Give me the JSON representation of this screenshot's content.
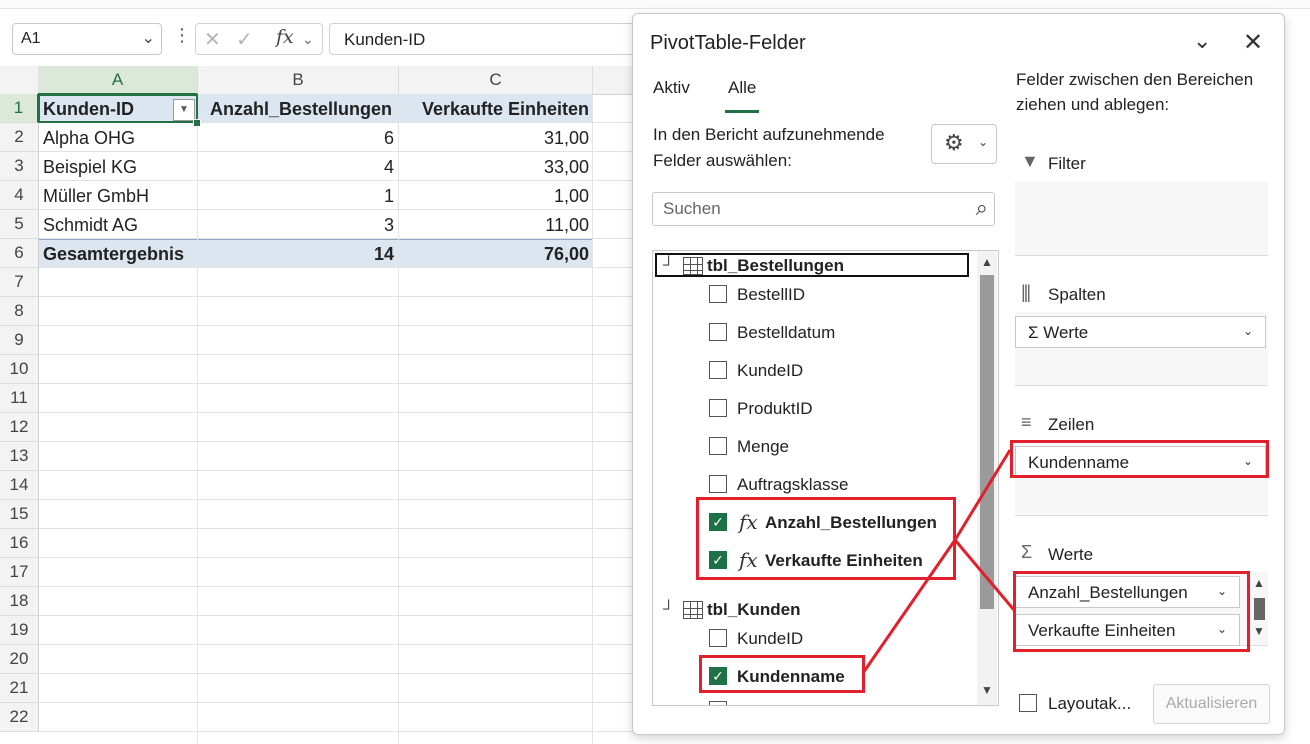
{
  "formula_bar": {
    "name_box": "A1",
    "fx_label": "fx",
    "content": "Kunden-ID"
  },
  "sheet": {
    "columns": [
      "A",
      "B",
      "C"
    ],
    "rows": [
      "1",
      "2",
      "3",
      "4",
      "5",
      "6",
      "7",
      "8",
      "9",
      "10",
      "11",
      "12",
      "13",
      "14",
      "15",
      "16",
      "17",
      "18",
      "19",
      "20",
      "21",
      "22"
    ],
    "headers": [
      "Kunden-ID",
      "Anzahl_Bestellungen",
      "Verkaufte Einheiten"
    ],
    "data": [
      [
        "Alpha OHG",
        "6",
        "31,00"
      ],
      [
        "Beispiel KG",
        "4",
        "33,00"
      ],
      [
        "Müller GmbH",
        "1",
        "1,00"
      ],
      [
        "Schmidt AG",
        "3",
        "11,00"
      ]
    ],
    "total": [
      "Gesamtergebnis",
      "14",
      "76,00"
    ]
  },
  "panel": {
    "title": "PivotTable-Felder",
    "tabs": [
      "Aktiv",
      "Alle"
    ],
    "active_tab": "Alle",
    "choose_fields": "In den Bericht aufzunehmende Felder auswählen:",
    "search_placeholder": "Suchen",
    "tables": [
      {
        "name": "tbl_Bestellungen",
        "fields": [
          {
            "label": "BestellID",
            "checked": false
          },
          {
            "label": "Bestelldatum",
            "checked": false
          },
          {
            "label": "KundeID",
            "checked": false
          },
          {
            "label": "ProduktID",
            "checked": false
          },
          {
            "label": "Menge",
            "checked": false
          },
          {
            "label": "Auftragsklasse",
            "checked": false
          },
          {
            "label": "Anzahl_Bestellungen",
            "checked": true,
            "calculated": true
          },
          {
            "label": "Verkaufte Einheiten",
            "checked": true,
            "calculated": true
          }
        ]
      },
      {
        "name": "tbl_Kunden",
        "fields": [
          {
            "label": "KundeID",
            "checked": false
          },
          {
            "label": "Kundenname",
            "checked": true
          }
        ]
      }
    ],
    "drag_text": "Felder zwischen den Bereichen ziehen und ablegen:",
    "areas": {
      "filter": {
        "title": "Filter"
      },
      "columns": {
        "title": "Spalten",
        "items": [
          "Σ Werte"
        ]
      },
      "rows": {
        "title": "Zeilen",
        "items": [
          "Kundenname"
        ]
      },
      "values": {
        "title": "Werte",
        "items": [
          "Anzahl_Bestellungen",
          "Verkaufte Einheiten"
        ]
      }
    },
    "layout_label": "Layoutak...",
    "refresh_label": "Aktualisieren"
  },
  "colors": {
    "accent": "#237044",
    "pivot_header": "#dce6f0",
    "annotation": "#e0202c",
    "checkbox": "#1e7145"
  }
}
